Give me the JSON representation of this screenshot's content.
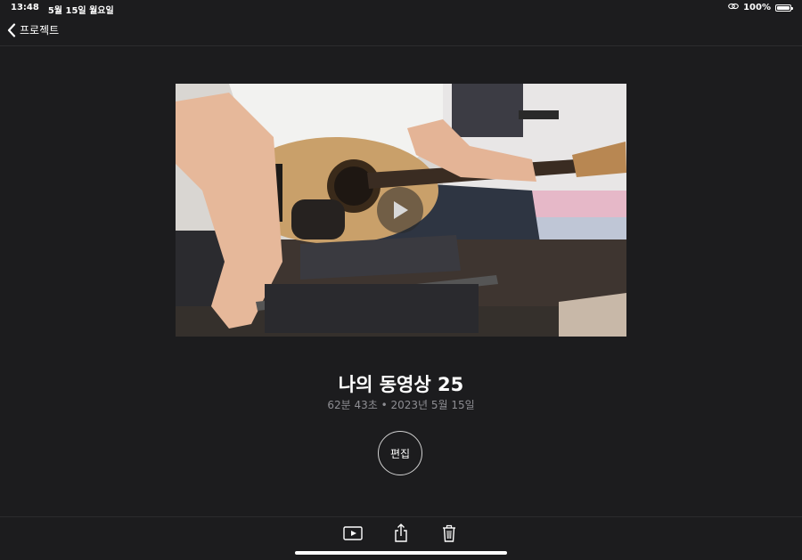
{
  "status_bar": {
    "time": "13:48",
    "date": "5월 15일 월요일",
    "battery_percent": "100%",
    "battery_level": 1.0,
    "icons": [
      "link-icon",
      "battery-icon"
    ]
  },
  "nav": {
    "back_label": "프로젝트",
    "back_icon": "chevron-left-icon"
  },
  "video": {
    "play_icon": "play-icon"
  },
  "project": {
    "title": "나의 동영상 25",
    "meta": "62분 43초 • 2023년 5월 15일"
  },
  "actions": {
    "edit_label": "편집"
  },
  "toolbar": {
    "items": [
      "play-video-icon",
      "share-icon",
      "trash-icon"
    ]
  },
  "colors": {
    "background": "#1c1c1e",
    "text_primary": "#ffffff",
    "text_secondary": "#8e8e93"
  }
}
